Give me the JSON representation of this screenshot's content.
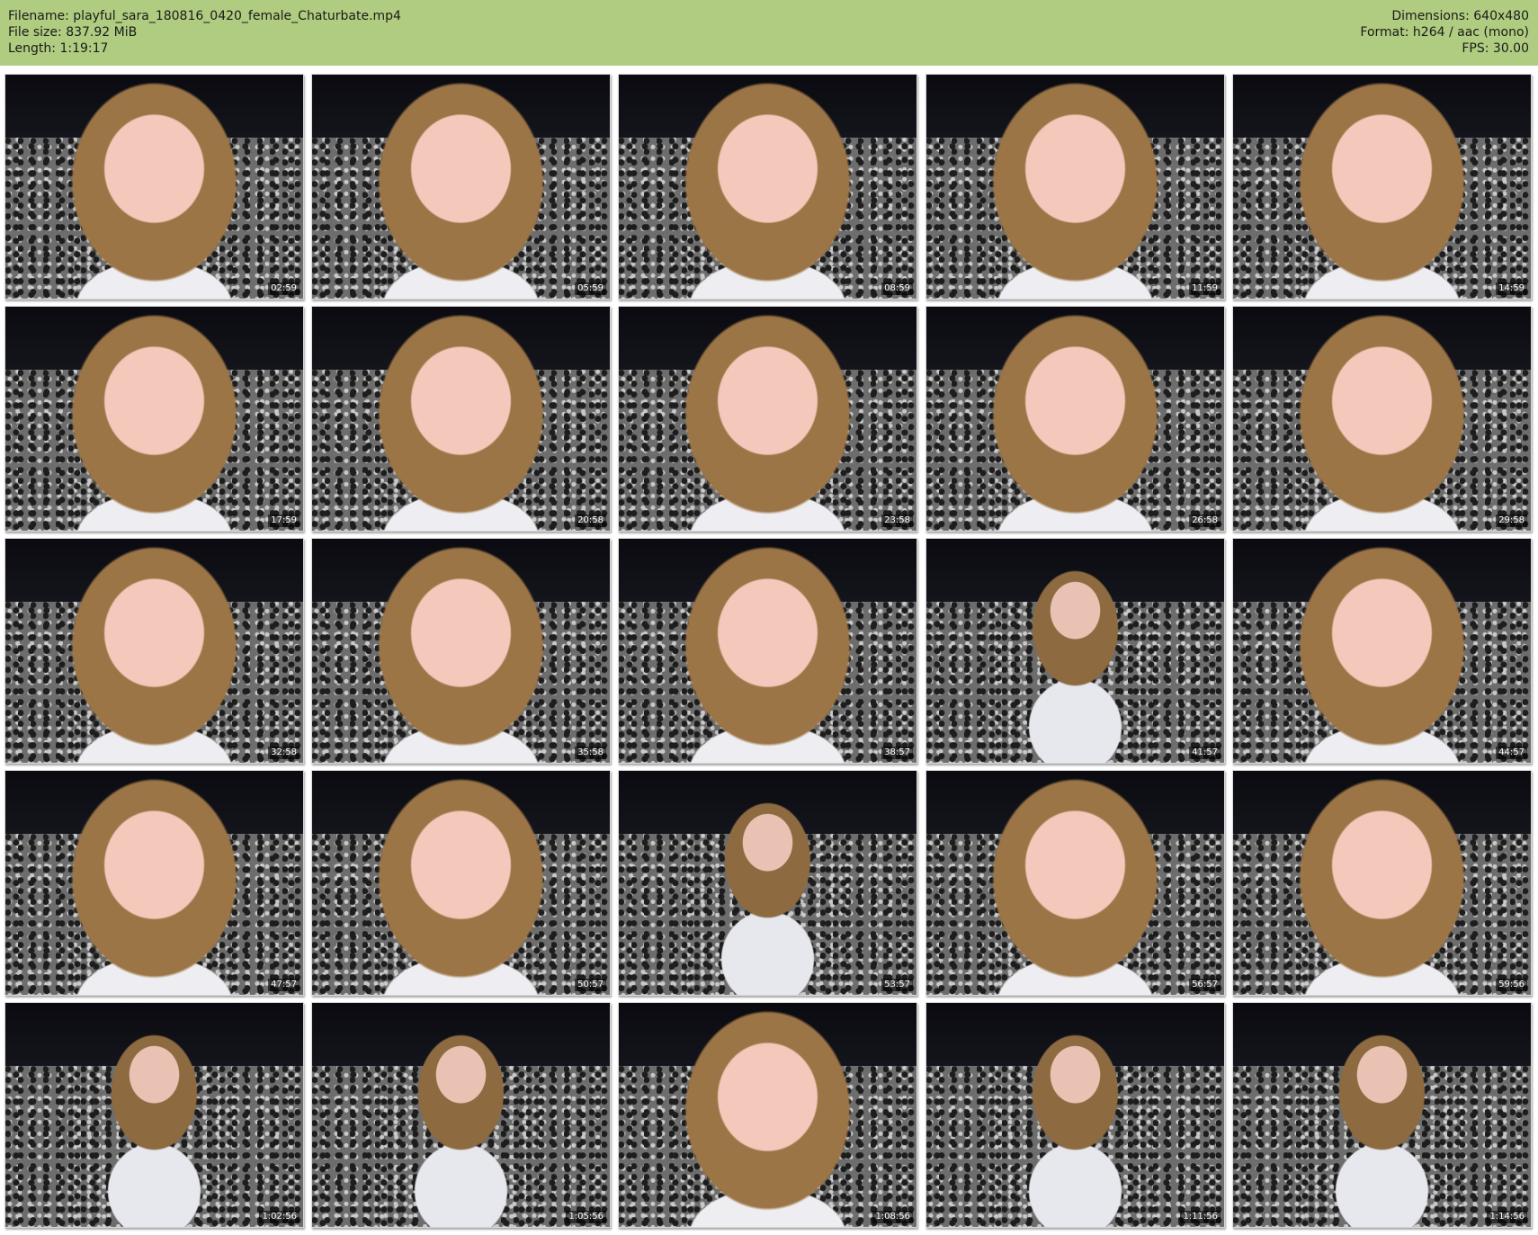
{
  "header": {
    "filename": "Filename: playful_sara_180816_0420_female_Chaturbate.mp4",
    "filesize": "File size: 837.92 MiB",
    "length": "Length: 1:19:17",
    "dimensions": "Dimensions: 640x480",
    "format": "Format: h264 / aac (mono)",
    "fps": "FPS: 30.00"
  },
  "colors": {
    "header_bg": "#b0cc80",
    "page_bg": "#ffffff"
  },
  "thumbnails": [
    {
      "timestamp": "02:59",
      "shot": "closeup"
    },
    {
      "timestamp": "05:59",
      "shot": "closeup"
    },
    {
      "timestamp": "08:59",
      "shot": "closeup"
    },
    {
      "timestamp": "11:59",
      "shot": "closeup"
    },
    {
      "timestamp": "14:59",
      "shot": "closeup"
    },
    {
      "timestamp": "17:59",
      "shot": "closeup"
    },
    {
      "timestamp": "20:58",
      "shot": "closeup"
    },
    {
      "timestamp": "23:58",
      "shot": "closeup"
    },
    {
      "timestamp": "26:58",
      "shot": "closeup"
    },
    {
      "timestamp": "29:58",
      "shot": "closeup"
    },
    {
      "timestamp": "32:58",
      "shot": "closeup"
    },
    {
      "timestamp": "35:58",
      "shot": "closeup"
    },
    {
      "timestamp": "38:57",
      "shot": "closeup"
    },
    {
      "timestamp": "41:57",
      "shot": "wide"
    },
    {
      "timestamp": "44:57",
      "shot": "closeup"
    },
    {
      "timestamp": "47:57",
      "shot": "closeup"
    },
    {
      "timestamp": "50:57",
      "shot": "closeup"
    },
    {
      "timestamp": "53:57",
      "shot": "wide"
    },
    {
      "timestamp": "56:57",
      "shot": "closeup"
    },
    {
      "timestamp": "59:56",
      "shot": "closeup"
    },
    {
      "timestamp": "1:02:56",
      "shot": "wide"
    },
    {
      "timestamp": "1:05:56",
      "shot": "wide"
    },
    {
      "timestamp": "1:08:56",
      "shot": "closeup"
    },
    {
      "timestamp": "1:11:56",
      "shot": "wide"
    },
    {
      "timestamp": "1:14:56",
      "shot": "wide"
    }
  ]
}
